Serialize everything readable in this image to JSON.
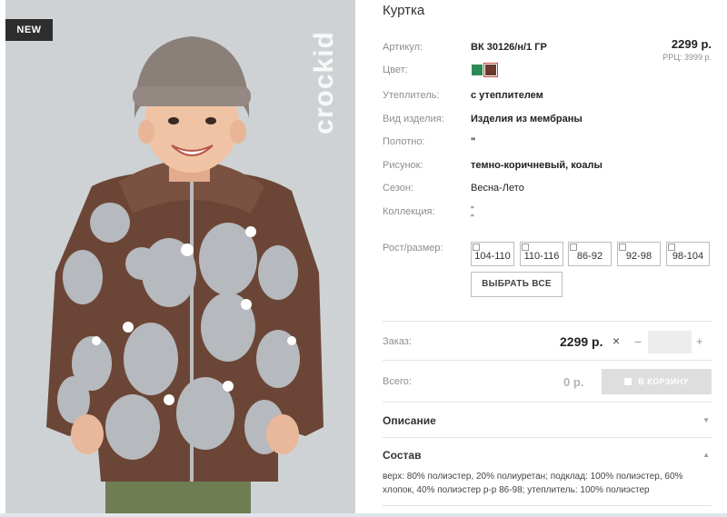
{
  "badge": "NEW",
  "brand": "crockid",
  "product": {
    "title": "Куртка",
    "price": "2299 р.",
    "rrp": "РРЦ: 3999 р."
  },
  "attributes": [
    {
      "label": "Артикул:",
      "value": "ВК 30126/н/1 ГР"
    },
    {
      "label": "Цвет:"
    },
    {
      "label": "Утеплитель:",
      "value": "с утеплителем"
    },
    {
      "label": "Вид изделия:",
      "value": "Изделия из мембраны"
    },
    {
      "label": "Полотно:",
      "value": "\""
    },
    {
      "label": "Рисунок:",
      "value": "темно-коричневый, коалы"
    },
    {
      "label": "Сезон:",
      "value": "Весна-Лето"
    },
    {
      "label": "Коллекция:",
      "value": "\"",
      "value2": "\""
    }
  ],
  "colors": [
    "#2e8a55",
    "#6b3a2c"
  ],
  "sizes": {
    "label": "Рост/размер:",
    "options": [
      "104-110",
      "110-116",
      "86-92",
      "92-98",
      "98-104"
    ],
    "select_all": "ВЫБРАТЬ ВСЕ"
  },
  "order": {
    "label": "Заказ:",
    "price": "2299 р.",
    "times": "×",
    "minus": "−",
    "plus": "+",
    "quantity": ""
  },
  "total": {
    "label": "Всего:",
    "value": "0 р.",
    "cart_button": "В КОРЗИНУ"
  },
  "sections": {
    "description": "Описание",
    "composition": "Состав",
    "composition_text": "верх: 80% полиэстер, 20% полиуретан; подклад: 100% полиэстер, 60% хлопок, 40% полиэстер р-р 86-98; утеплитель: 100% полиэстер"
  },
  "icons": {
    "collapsed": "caret-down-icon",
    "expanded": "caret-up-icon"
  }
}
